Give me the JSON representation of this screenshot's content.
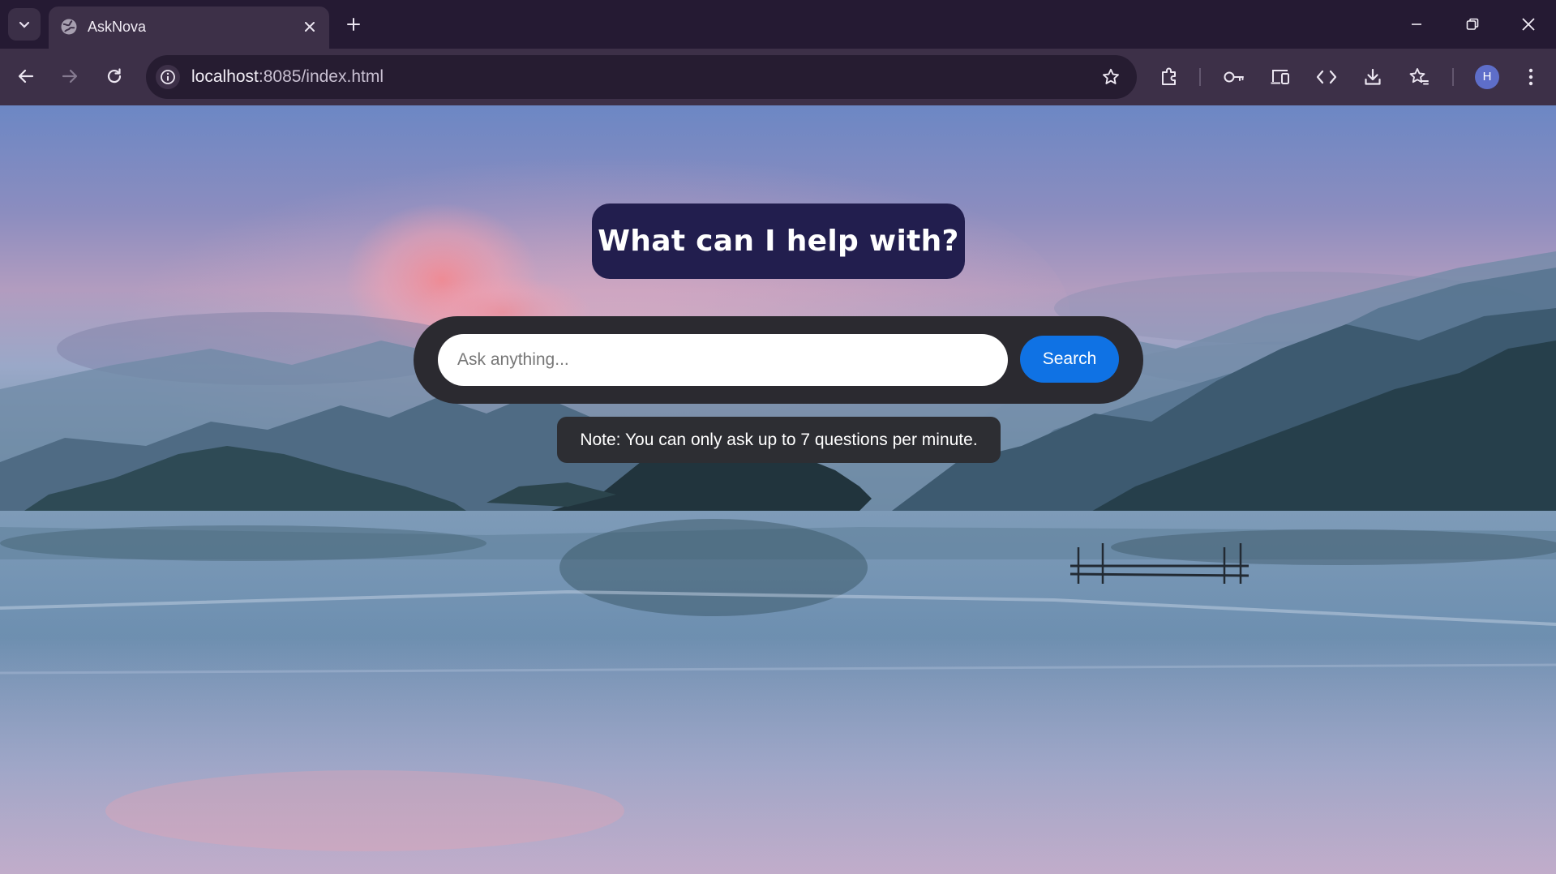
{
  "browser": {
    "tab_title": "AskNova",
    "url_host": "localhost",
    "url_path": ":8085/index.html",
    "profile_initial": "H"
  },
  "page": {
    "headline": "What can I help with?",
    "search": {
      "placeholder": "Ask anything...",
      "value": "",
      "button_label": "Search"
    },
    "note": "Note: You can only ask up to 7 questions per minute."
  },
  "colors": {
    "headline_bg": "#221e4e",
    "search_button": "#0f72e4",
    "search_bar_bg": "#2b2a30",
    "note_bg": "#2d2e33"
  },
  "icons": {
    "toolbar": [
      "back-icon",
      "forward-icon",
      "reload-icon",
      "info-icon",
      "bookmark-star-icon",
      "extensions-icon",
      "password-key-icon",
      "device-icon",
      "devtools-code-icon",
      "download-icon",
      "reading-list-icon",
      "menu-icon"
    ]
  }
}
